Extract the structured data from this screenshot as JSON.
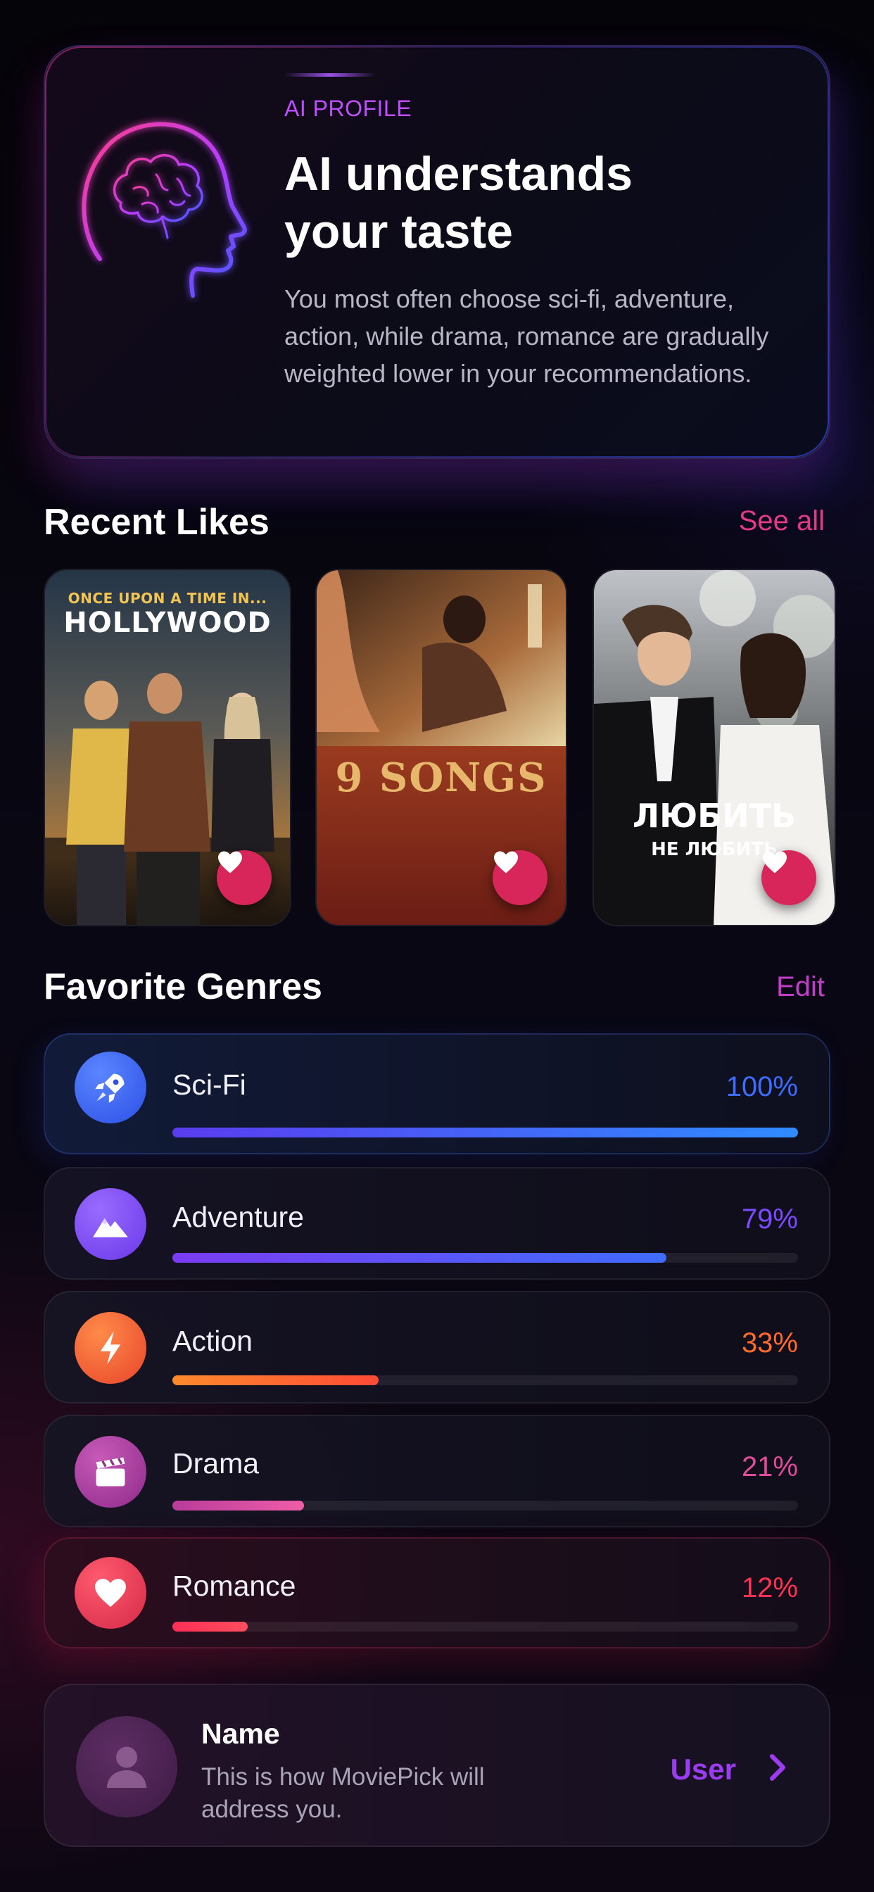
{
  "hero": {
    "kicker": "AI PROFILE",
    "title_line1": "AI understands",
    "title_line2": "your taste",
    "description": "You most often choose sci-fi, adventure, action, while drama, romance are gradually weighted lower in your recommendations.",
    "icon": "brain-head-icon"
  },
  "recent_likes": {
    "title": "Recent Likes",
    "see_all": "See all",
    "posters": [
      {
        "kicker": "ONCE UPON A TIME IN...",
        "title": "HOLLYWOOD",
        "liked": true
      },
      {
        "title": "9 SONGS",
        "liked": true
      },
      {
        "title": "ЛЮБИТЬ",
        "subtitle": "НЕ ЛЮБИТЬ",
        "liked": true
      }
    ]
  },
  "favorite_genres": {
    "title": "Favorite Genres",
    "edit": "Edit",
    "items": [
      {
        "name": "Sci-Fi",
        "percent_label": "100%",
        "value": 100,
        "icon": "rocket-icon",
        "color": "#3d6cff"
      },
      {
        "name": "Adventure",
        "percent_label": "79%",
        "value": 79,
        "icon": "mountain-icon",
        "color": "#7a4bff"
      },
      {
        "name": "Action",
        "percent_label": "33%",
        "value": 33,
        "icon": "lightning-icon",
        "color": "#ff6a2b"
      },
      {
        "name": "Drama",
        "percent_label": "21%",
        "value": 21,
        "icon": "clapperboard-icon",
        "color": "#e04c9c"
      },
      {
        "name": "Romance",
        "percent_label": "12%",
        "value": 12,
        "icon": "heart-icon",
        "color": "#ff3355"
      }
    ]
  },
  "name_card": {
    "title": "Name",
    "description": "This is how MoviePick will address you.",
    "value": "User"
  },
  "colors": {
    "accent_pink": "#e33a86",
    "accent_purple": "#c04dff",
    "heart_button": "#d8265a"
  }
}
